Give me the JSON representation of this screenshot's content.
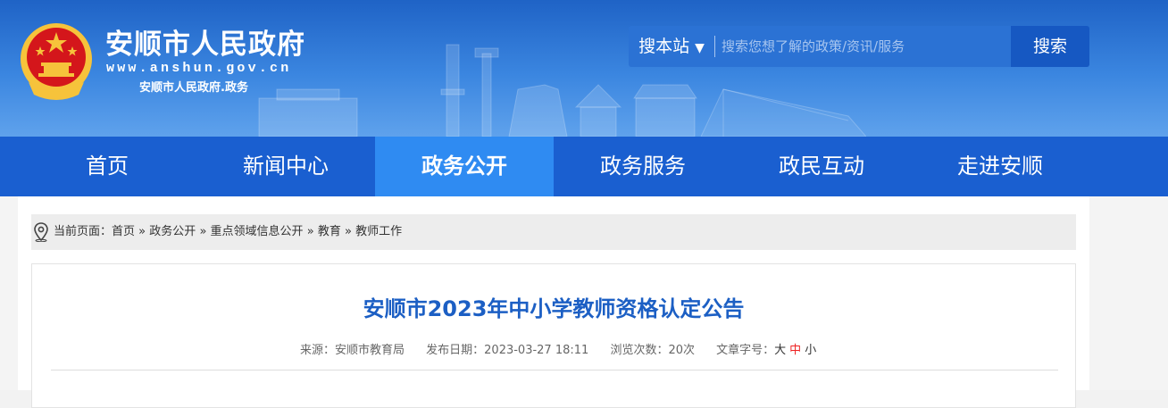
{
  "header": {
    "site_title": "安顺市人民政府",
    "site_url": "www.anshun.gov.cn",
    "site_subtitle": "安顺市人民政府.政务",
    "search": {
      "scope_label": "搜本站",
      "placeholder": "搜索您想了解的政策/资讯/服务",
      "button_label": "搜索"
    }
  },
  "nav": {
    "items": [
      {
        "label": "首页"
      },
      {
        "label": "新闻中心"
      },
      {
        "label": "政务公开"
      },
      {
        "label": "政务服务"
      },
      {
        "label": "政民互动"
      },
      {
        "label": "走进安顺"
      }
    ],
    "active_index": 2
  },
  "breadcrumb": {
    "prefix": "当前页面：",
    "items": [
      "首页",
      "政务公开",
      "重点领域信息公开",
      "教育",
      "教师工作"
    ],
    "separator": "»"
  },
  "article": {
    "title": "安顺市2023年中小学教师资格认定公告",
    "source": "来源：安顺市教育局",
    "publish_date": "发布日期：2023-03-27 18:11",
    "views": "浏览次数：20次",
    "font_size_label": "文章字号：",
    "font_sizes": [
      "大",
      "中",
      "小"
    ],
    "active_font_size": "中"
  },
  "colors": {
    "header_blue": "#1f63c6",
    "nav_blue": "#1a5fd0",
    "nav_active": "#2f8bf2",
    "title_blue": "#1c5fc4",
    "emblem_red": "#d4161b",
    "emblem_gold": "#f6c33b"
  }
}
